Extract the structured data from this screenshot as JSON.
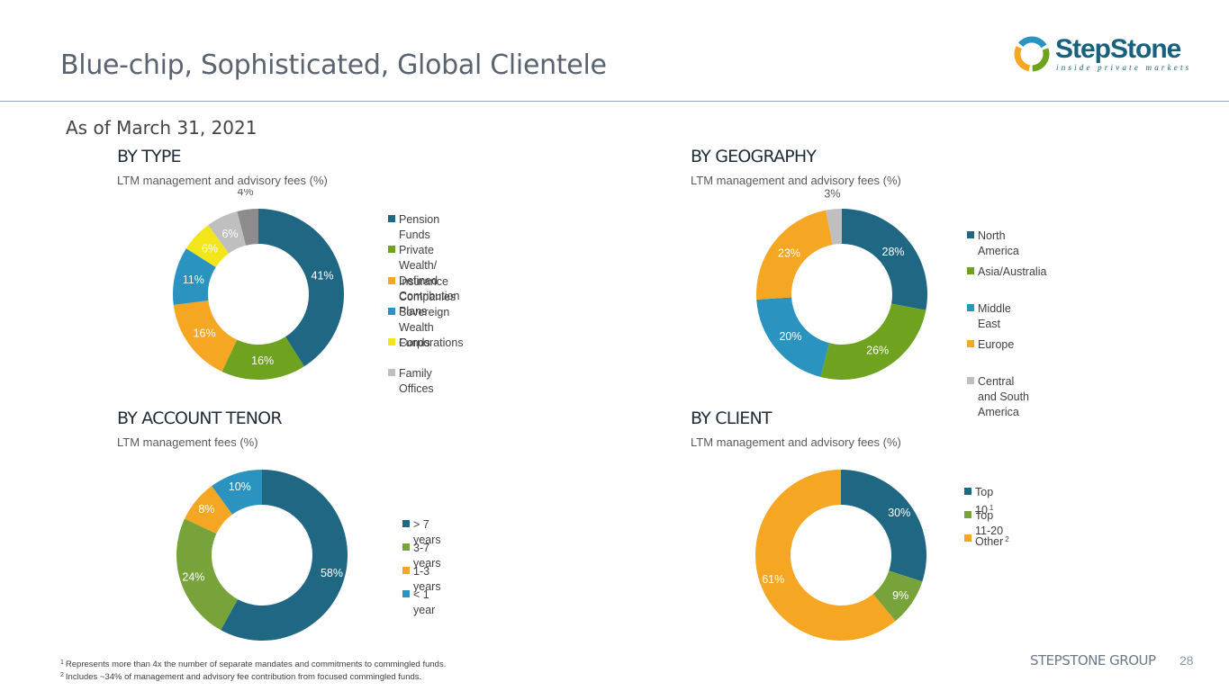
{
  "header": {
    "title": "Blue-chip, Sophisticated, Global Clientele",
    "logo_text": "StepStone",
    "logo_tagline": "inside private markets"
  },
  "as_of": "As of March 31, 2021",
  "colors": {
    "dark_teal": "#1f6783",
    "green": "#6fa21e",
    "orange": "#f5a623",
    "blue": "#2a93bf",
    "yellow": "#f2e51a",
    "gray": "#bfbfbf",
    "dark_gray": "#8c8c8c",
    "olive_green": "#78a33a",
    "top10_teal": "#1f6783"
  },
  "chart_data": [
    {
      "type": "pie",
      "title": "BY TYPE",
      "subtitle": "LTM management and advisory fees (%)",
      "categories": [
        "Pension Funds",
        "Private Wealth/\nDefined Contribution Plans",
        "Insurance Companies",
        "Sovereign Wealth Funds",
        "Corporations",
        "Family Offices",
        ""
      ],
      "values": [
        41,
        16,
        16,
        11,
        6,
        6,
        4
      ],
      "labels": [
        "41%",
        "16%",
        "16%",
        "11%",
        "6%",
        "6%",
        "4%"
      ],
      "colors": [
        "#1f6783",
        "#6fa21e",
        "#f5a623",
        "#2a93bf",
        "#f2e51a",
        "#bfbfbf",
        "#8c8c8c"
      ],
      "donut": true
    },
    {
      "type": "pie",
      "title": "BY GEOGRAPHY",
      "subtitle": "LTM management and advisory fees (%)",
      "categories": [
        "North America",
        "Asia/Australia",
        "Middle East",
        "Europe",
        "Central and South\nAmerica"
      ],
      "values": [
        28,
        26,
        20,
        23,
        3
      ],
      "labels": [
        "28%",
        "26%",
        "20%",
        "23%",
        "3%"
      ],
      "colors": [
        "#1f6783",
        "#6fa21e",
        "#2a93bf",
        "#f5a623",
        "#bfbfbf"
      ],
      "donut": true
    },
    {
      "type": "pie",
      "title": "BY ACCOUNT TENOR",
      "subtitle": "LTM management fees (%)",
      "categories": [
        "> 7 years",
        "3-7 years",
        "1-3 years",
        "< 1 year"
      ],
      "values": [
        58,
        24,
        8,
        10
      ],
      "labels": [
        "58%",
        "24%",
        "8%",
        "10%"
      ],
      "colors": [
        "#1f6783",
        "#78a33a",
        "#f5a623",
        "#2a93bf"
      ],
      "donut": true
    },
    {
      "type": "pie",
      "title": "BY CLIENT",
      "subtitle": "LTM management and advisory fees (%)",
      "categories": [
        "Top 10",
        "Top 11-20",
        "Other"
      ],
      "category_sups": [
        "1",
        "",
        "2"
      ],
      "values": [
        30,
        9,
        61
      ],
      "labels": [
        "30%",
        "9%",
        "61%"
      ],
      "colors": [
        "#1f6783",
        "#78a33a",
        "#f5a623"
      ],
      "donut": true
    }
  ],
  "footnotes": [
    {
      "sup": "1",
      "text": "Represents more than 4x the number of separate mandates and commitments to commingled funds."
    },
    {
      "sup": "2",
      "text": "Includes ~34% of management and advisory fee contribution from focused commingled funds."
    }
  ],
  "footer": {
    "brand": "STEPSTONE GROUP",
    "page": "28"
  }
}
